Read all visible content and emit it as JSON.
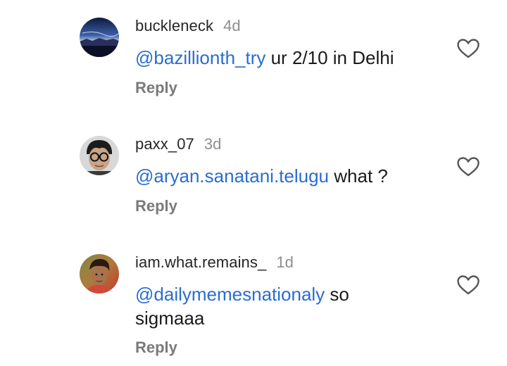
{
  "comments": [
    {
      "username": "buckleneck",
      "time": "4d",
      "mention": "@bazillionth_try",
      "text": " ur 2/10 in Delhi",
      "reply_label": "Reply",
      "avatar_icon": "landscape-sunset-avatar",
      "like_icon": "heart-outline-icon"
    },
    {
      "username": "paxx_07",
      "time": "3d",
      "mention": "@aryan.sanatani.telugu",
      "text": " what ?",
      "reply_label": "Reply",
      "avatar_icon": "person-glasses-avatar",
      "like_icon": "heart-outline-icon"
    },
    {
      "username": "iam.what.remains_",
      "time": "1d",
      "mention": "@dailymemesnationaly",
      "text": " so sigmaaa",
      "reply_label": "Reply",
      "avatar_icon": "person-photo-avatar",
      "like_icon": "heart-outline-icon"
    }
  ],
  "colors": {
    "mention": "#2a6dcf",
    "muted": "#8e8e8e",
    "text": "#1a1a1a"
  }
}
